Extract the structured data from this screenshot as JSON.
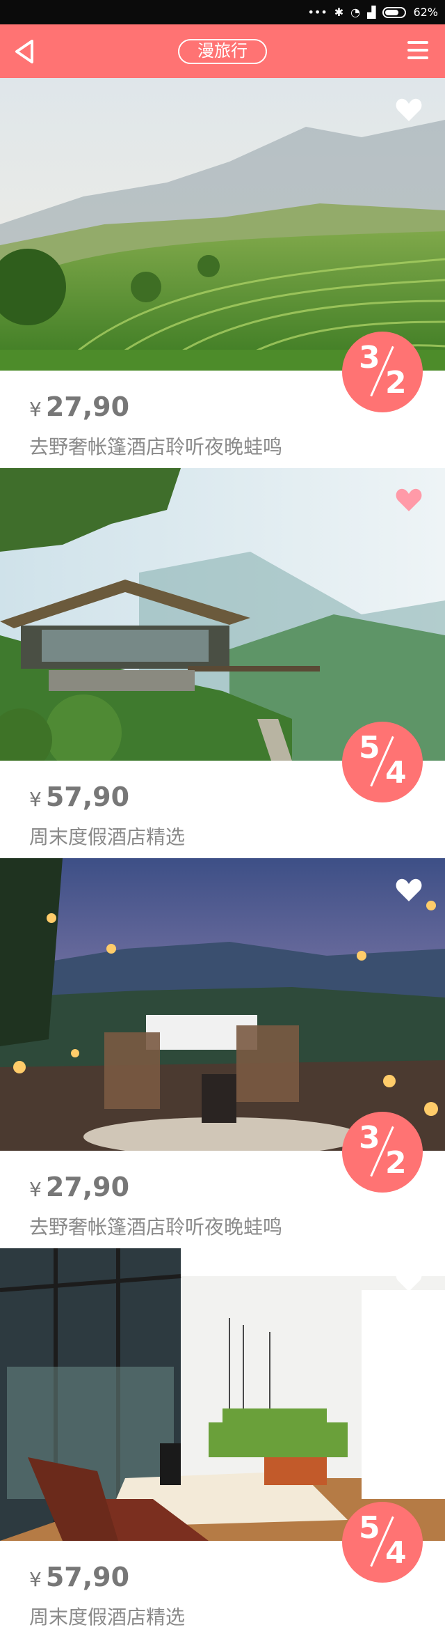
{
  "status_bar": {
    "icons": [
      "dots-icon",
      "bluetooth-icon",
      "wifi-icon",
      "signal-icon"
    ],
    "battery": "62%"
  },
  "nav": {
    "title": "漫旅行",
    "back_icon": "back-triangle-icon",
    "menu_icon": "hamburger-menu-icon"
  },
  "cards": [
    {
      "price_currency": "¥",
      "price": "27,90",
      "description": "去野奢帐篷酒店聆听夜晚蛙鸣",
      "badge_top": "3",
      "badge_bottom": "2",
      "favorited": false
    },
    {
      "price_currency": "¥",
      "price": "57,90",
      "description": "周末度假酒店精选",
      "badge_top": "5",
      "badge_bottom": "4",
      "favorited": true
    },
    {
      "price_currency": "¥",
      "price": "27,90",
      "description": "去野奢帐篷酒店聆听夜晚蛙鸣",
      "badge_top": "3",
      "badge_bottom": "2",
      "favorited": false
    },
    {
      "price_currency": "¥",
      "price": "57,90",
      "description": "周末度假酒店精选",
      "badge_top": "5",
      "badge_bottom": "4",
      "favorited": false
    }
  ],
  "colors": {
    "accent": "#ff7373",
    "text_gray": "#8a8a8a",
    "heart_active": "#ff9aa8",
    "heart_inactive": "#ffffff"
  }
}
